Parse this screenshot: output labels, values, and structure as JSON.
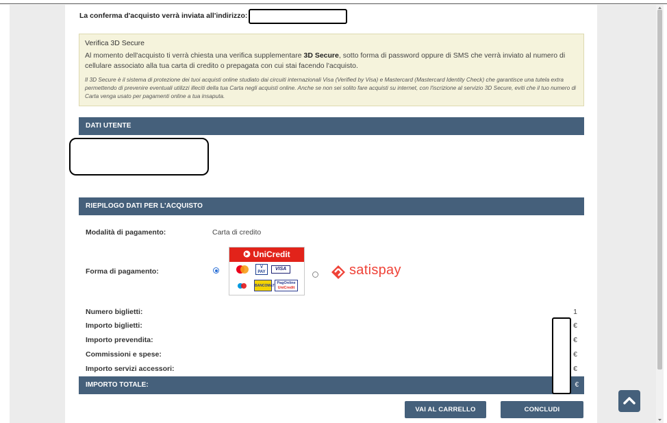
{
  "confirm": {
    "label": "La conferma d'acquisto verrà inviata all'indirizzo:"
  },
  "secure3d": {
    "title": "Verifica 3D Secure",
    "p1_before": "Al momento dell'acquisto ti verrà chiesta una verifica supplementare ",
    "p1_bold": "3D Secure",
    "p1_after": ", sotto forma di password oppure di SMS che verrà inviato al numero di cellulare associato alla tua carta di credito o prepagata con cui stai facendo l'acquisto.",
    "p2": "Il 3D Secure è il sistema di protezione dei tuoi acquisti online studiato dai circuiti internazionali Visa (Verified by Visa) e Mastercard (Mastercard Identity Check) che garantisce una tutela extra permettendo di prevenire eventuali utilizzi illeciti della tua Carta negli acquisti online. Anche se non sei solito fare acquisti su internet, con l'iscrizione al servizio 3D Secure, eviti che il tuo numero di Carta venga usato per pagamenti online a tua insaputa."
  },
  "sections": {
    "user": "DATI UTENTE",
    "summary": "RIEPILOGO DATI PER L'ACQUISTO"
  },
  "payment": {
    "mode_label": "Modalità di pagamento:",
    "mode_value": "Carta di credito",
    "form_label": "Forma di pagamento:",
    "unicredit_brand": "UniCredit",
    "unicredit_logos": [
      "mastercard",
      "V PAY",
      "VISA",
      "maestro",
      "BANCOMAT",
      "PagOnline UniCredit"
    ],
    "satispay_brand": "satispay",
    "selected": "unicredit"
  },
  "summary": {
    "rows": [
      {
        "label": "Numero biglietti:",
        "value": "1"
      },
      {
        "label": "Importo biglietti:",
        "value": "€"
      },
      {
        "label": "Importo prevendita:",
        "value": "€"
      },
      {
        "label": "Commissioni e spese:",
        "value": "€"
      },
      {
        "label": "Importo servizi accessori:",
        "value": "€"
      }
    ],
    "total_label": "IMPORTO TOTALE:",
    "total_value": "€"
  },
  "buttons": {
    "cart": "VAI AL CARRELLO",
    "conclude": "CONCLUDI"
  },
  "colors": {
    "bar": "#45607b",
    "secure_bg": "#f5f3dc",
    "unicredit_red": "#e2231a",
    "satispay_red": "#ef4237"
  },
  "icons": {
    "scroll_top": "chevron-up-icon",
    "satispay_mark": "satispay-logo-icon"
  }
}
